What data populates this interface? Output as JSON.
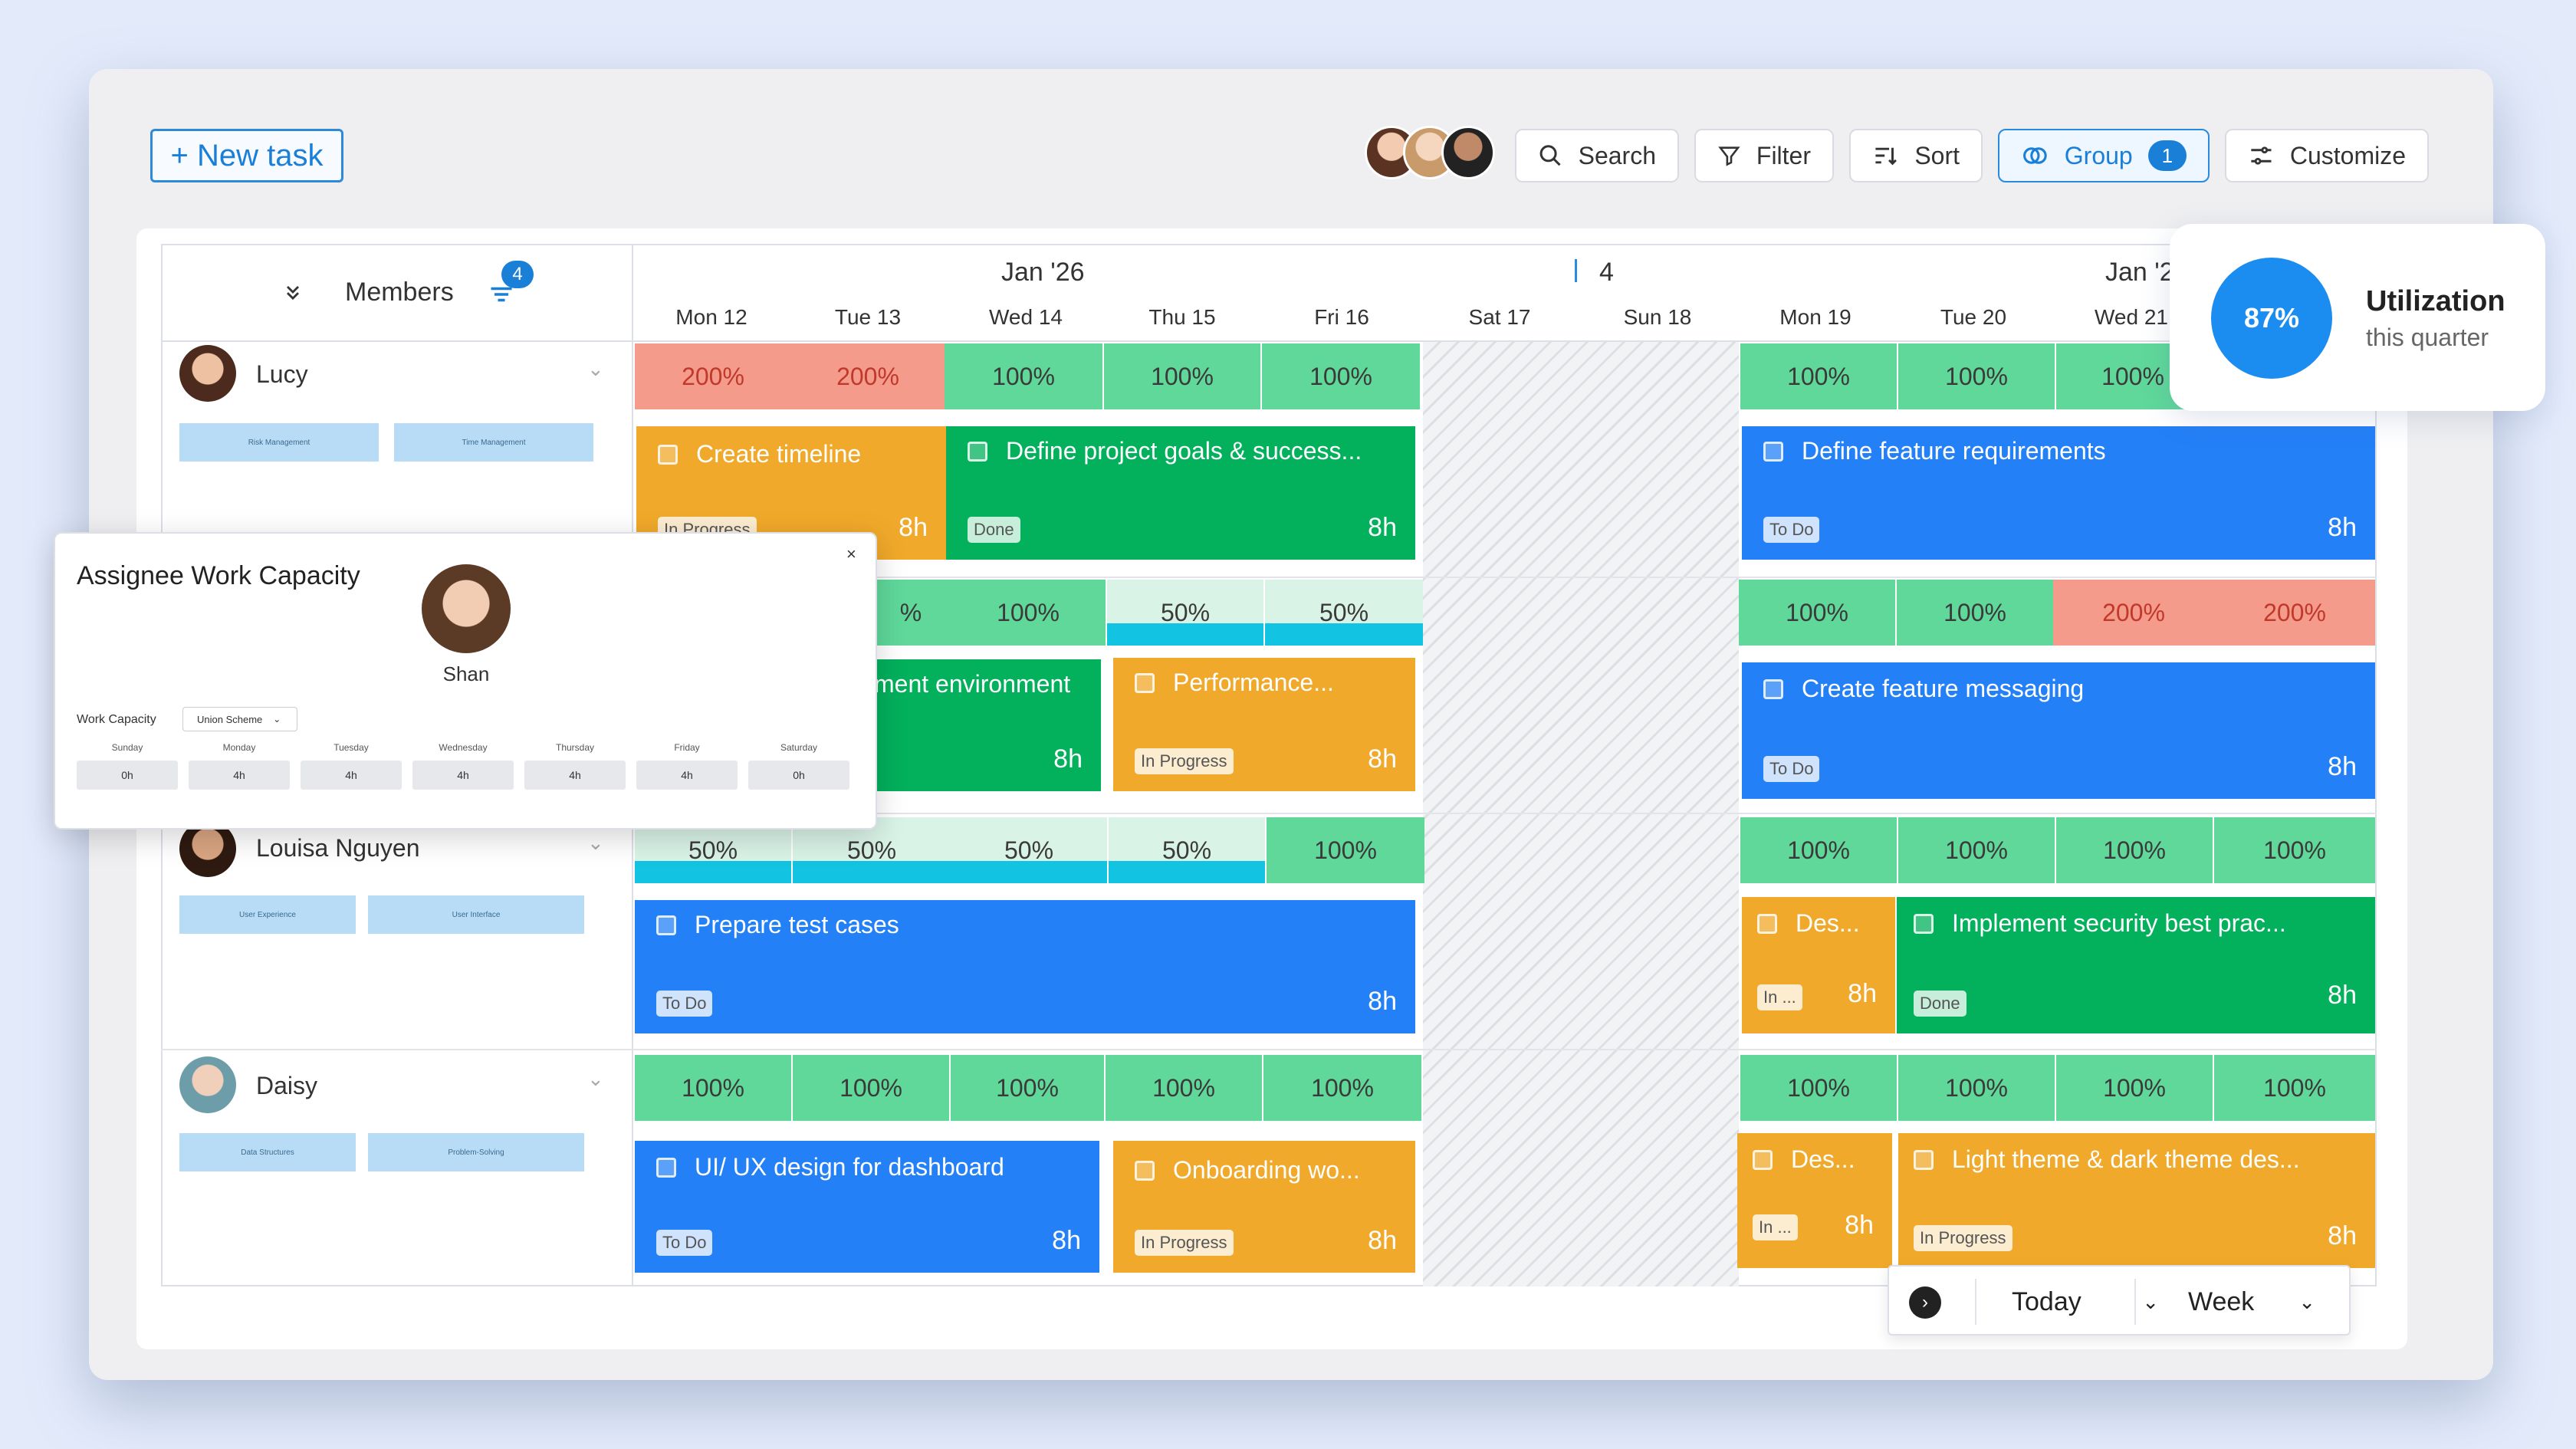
{
  "toolbar": {
    "new_task": "+ New task",
    "search": "Search",
    "filter": "Filter",
    "sort": "Sort",
    "group": "Group",
    "group_count": "1",
    "customize": "Customize"
  },
  "header": {
    "members_label": "Members",
    "members_count": "4",
    "month_left": "Jan '26",
    "week_marker": "4",
    "month_right": "Jan '2",
    "days": [
      "Mon 12",
      "Tue 13",
      "Wed 14",
      "Thu 15",
      "Fri 16",
      "Sat 17",
      "Sun 18",
      "Mon 19",
      "Tue 20",
      "Wed 21"
    ]
  },
  "members": [
    {
      "name": "Lucy",
      "skills": [
        "Risk Management",
        "Time Management"
      ]
    },
    {
      "name": "Louisa Nguyen",
      "skills": [
        "User Experience",
        "User Interface"
      ]
    },
    {
      "name": "Daisy",
      "skills": [
        "Data Structures",
        "Problem-Solving"
      ]
    }
  ],
  "capacity": {
    "row1": [
      "200%",
      "200%",
      "100%",
      "100%",
      "100%",
      "100%",
      "100%",
      "100%"
    ],
    "row2": [
      "%",
      "100%",
      "50%",
      "50%",
      "100%",
      "100%",
      "200%",
      "200%"
    ],
    "row3": [
      "50%",
      "50%",
      "50%",
      "50%",
      "100%",
      "100%",
      "100%",
      "100%",
      "100%"
    ],
    "row4": [
      "100%",
      "100%",
      "100%",
      "100%",
      "100%",
      "100%",
      "100%",
      "100%",
      "100%"
    ]
  },
  "tasks": {
    "t1": {
      "title": "Create timeline",
      "status": "In Progress",
      "hours": "8h"
    },
    "t2": {
      "title": "Define project goals & success...",
      "status": "Done",
      "hours": "8h"
    },
    "t3": {
      "title": "Define feature requirements",
      "status": "To Do",
      "hours": "8h"
    },
    "t4": {
      "title": "ment environment",
      "hours": "8h"
    },
    "t5": {
      "title": "Performance...",
      "status": "In Progress",
      "hours": "8h"
    },
    "t6": {
      "title": "Create feature messaging",
      "status": "To Do",
      "hours": "8h"
    },
    "t7": {
      "title": "Prepare test cases",
      "status": "To Do",
      "hours": "8h"
    },
    "t8": {
      "title": "Des...",
      "status": "In ...",
      "hours": "8h"
    },
    "t9": {
      "title": "Implement security best prac...",
      "status": "Done",
      "hours": "8h"
    },
    "t10": {
      "title": "UI/ UX design for dashboard",
      "status": "To Do",
      "hours": "8h"
    },
    "t11": {
      "title": "Onboarding wo...",
      "status": "In Progress",
      "hours": "8h"
    },
    "t12": {
      "title": "Des...",
      "status": "In ...",
      "hours": "8h"
    },
    "t13": {
      "title": "Light theme & dark theme des...",
      "status": "In Progress",
      "hours": "8h"
    }
  },
  "popup": {
    "title": "Assignee Work Capacity",
    "person": "Shan",
    "close": "×",
    "capacity_label": "Work Capacity",
    "scheme": "Union Scheme",
    "days": [
      "Sunday",
      "Monday",
      "Tuesday",
      "Wednesday",
      "Thursday",
      "Friday",
      "Saturday"
    ],
    "values": [
      "0h",
      "4h",
      "4h",
      "4h",
      "4h",
      "4h",
      "0h"
    ]
  },
  "utilization": {
    "percent": "87%",
    "title": "Utilization",
    "subtitle": "this quarter"
  },
  "footer": {
    "today": "Today",
    "week": "Week"
  },
  "colors": {
    "accent": "#1a7fd6",
    "green": "#5fd89a",
    "red": "#f49b8c",
    "blue": "#2480f7",
    "orange": "#f0a92a",
    "dark_green": "#03b05c"
  }
}
